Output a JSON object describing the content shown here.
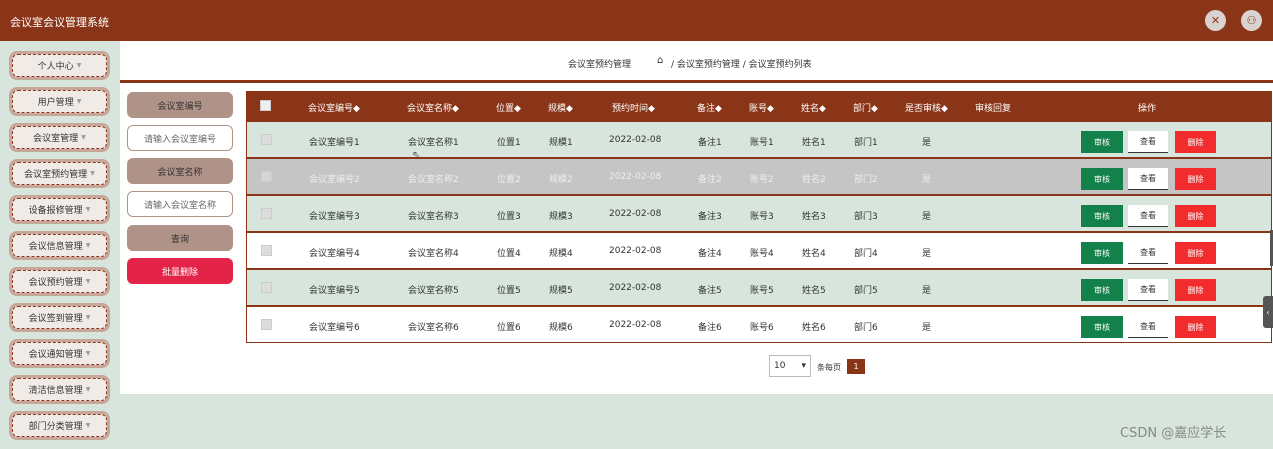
{
  "app": {
    "title": "会议室会议管理系统"
  },
  "header_icons": [
    "fullscreen-icon",
    "user-icon"
  ],
  "sidebar": {
    "items": [
      {
        "label": "个人中心"
      },
      {
        "label": "用户管理"
      },
      {
        "label": "会议室管理"
      },
      {
        "label": "会议室预约管理"
      },
      {
        "label": "设备报修管理"
      },
      {
        "label": "会议信息管理"
      },
      {
        "label": "会议预约管理"
      },
      {
        "label": "会议签到管理"
      },
      {
        "label": "会议通知管理"
      },
      {
        "label": "清洁信息管理"
      },
      {
        "label": "部门分类管理"
      }
    ]
  },
  "breadcrumb": {
    "page_title": "会议室预约管理",
    "path": "/ 会议室预约管理 / 会议室预约列表"
  },
  "search": {
    "field1_label": "会议室编号",
    "field1_placeholder": "请输入会议室编号",
    "field2_label": "会议室名称",
    "field2_placeholder": "请输入会议室名称",
    "query_button": "查询",
    "batch_delete_button": "批量删除"
  },
  "table": {
    "headers": [
      "会议室编号◆",
      "会议室名称◆",
      "位置◆",
      "规模◆",
      "预约时间◆",
      "备注◆",
      "账号◆",
      "姓名◆",
      "部门◆",
      "是否审核◆",
      "审核回复",
      "操作"
    ],
    "rows": [
      {
        "c1": "会议室编号1",
        "c2": "会议室名称1",
        "c3": "位置1",
        "c4": "规模1",
        "c5": "2022-02-08",
        "c6": "备注1",
        "c7": "账号1",
        "c8": "姓名1",
        "c9": "部门1",
        "c10": "是"
      },
      {
        "c1": "会议室编号2",
        "c2": "会议室名称2",
        "c3": "位置2",
        "c4": "规模2",
        "c5": "2022-02-08",
        "c6": "备注2",
        "c7": "账号2",
        "c8": "姓名2",
        "c9": "部门2",
        "c10": "是"
      },
      {
        "c1": "会议室编号3",
        "c2": "会议室名称3",
        "c3": "位置3",
        "c4": "规模3",
        "c5": "2022-02-08",
        "c6": "备注3",
        "c7": "账号3",
        "c8": "姓名3",
        "c9": "部门3",
        "c10": "是"
      },
      {
        "c1": "会议室编号4",
        "c2": "会议室名称4",
        "c3": "位置4",
        "c4": "规模4",
        "c5": "2022-02-08",
        "c6": "备注4",
        "c7": "账号4",
        "c8": "姓名4",
        "c9": "部门4",
        "c10": "是"
      },
      {
        "c1": "会议室编号5",
        "c2": "会议室名称5",
        "c3": "位置5",
        "c4": "规模5",
        "c5": "2022-02-08",
        "c6": "备注5",
        "c7": "账号5",
        "c8": "姓名5",
        "c9": "部门5",
        "c10": "是"
      },
      {
        "c1": "会议室编号6",
        "c2": "会议室名称6",
        "c3": "位置6",
        "c4": "规模6",
        "c5": "2022-02-08",
        "c6": "备注6",
        "c7": "账号6",
        "c8": "姓名6",
        "c9": "部门6",
        "c10": "是"
      }
    ],
    "actions": {
      "audit": "审核",
      "view": "查看",
      "delete": "删除"
    }
  },
  "pagination": {
    "page_size": "10",
    "per_page_label": "条每页",
    "current_page": "1"
  },
  "watermark": "CSDN @嘉应学长",
  "colors": {
    "brand": "#8b3518",
    "sidebar_bg": "#d7e5dd",
    "row_alt": "#d7e5dd",
    "row_hover": "#c5c5c5",
    "audit_btn": "#14804a",
    "delete_btn": "#f22c2c",
    "batch_delete": "#e32348"
  }
}
